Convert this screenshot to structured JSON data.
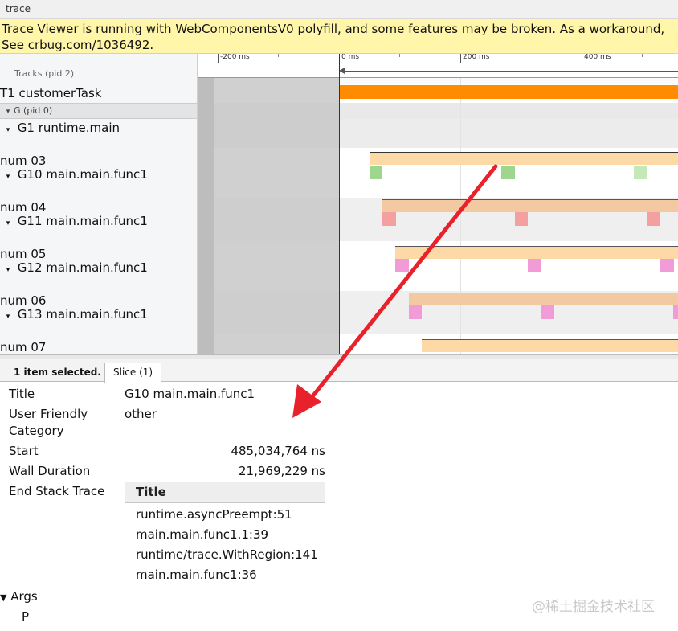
{
  "window": {
    "title": "trace"
  },
  "warning": {
    "line1": "Trace Viewer is running with WebComponentsV0 polyfill, and some features may be broken. As a workaround,",
    "line2": "See crbug.com/1036492."
  },
  "ruler": {
    "ticks": [
      "-200 ms",
      "0 ms",
      "200 ms",
      "400 ms"
    ]
  },
  "rows": {
    "tracks_header": "Tracks (pid 2)",
    "t1": "T1 customerTask",
    "g_header": "G (pid 0)",
    "g1": "G1 runtime.main",
    "num03": "num 03",
    "g10": "G10 main.main.func1",
    "num04": "num 04",
    "g11": "G11 main.main.func1",
    "num05": "num 05",
    "g12": "G12 main.main.func1",
    "num06": "num 06",
    "g13": "G13 main.main.func1",
    "num07": "num 07"
  },
  "colors": {
    "customer_task": "#ff8c00",
    "region_bar": "#fdd9a8",
    "region_bar_alt": "#f2c9a0",
    "green_slice": "#9fd68f",
    "green_slice_light": "#c5e8b8",
    "red_slice": "#f5a0a0",
    "pink_slice": "#f19cd6",
    "annotation_arrow": "#e8212b"
  },
  "details": {
    "selection_text": "1 item selected.",
    "tab_label": "Slice (1)",
    "title_key": "Title",
    "title_value": "G10 main.main.func1",
    "category_key_1": "User Friendly",
    "category_key_2": "Category",
    "category_value": "other",
    "start_key": "Start",
    "start_value": "485,034,764 ns",
    "wall_key": "Wall Duration",
    "wall_value": "21,969,229 ns",
    "stack_key": "End Stack Trace",
    "stack_header": "Title",
    "stack": [
      "runtime.asyncPreempt:51",
      "main.main.func1.1:39",
      "runtime/trace.WithRegion:141",
      "main.main.func1:36"
    ],
    "args_label": "Args",
    "args_item": "P"
  },
  "watermark": "@稀土掘金技术社区"
}
